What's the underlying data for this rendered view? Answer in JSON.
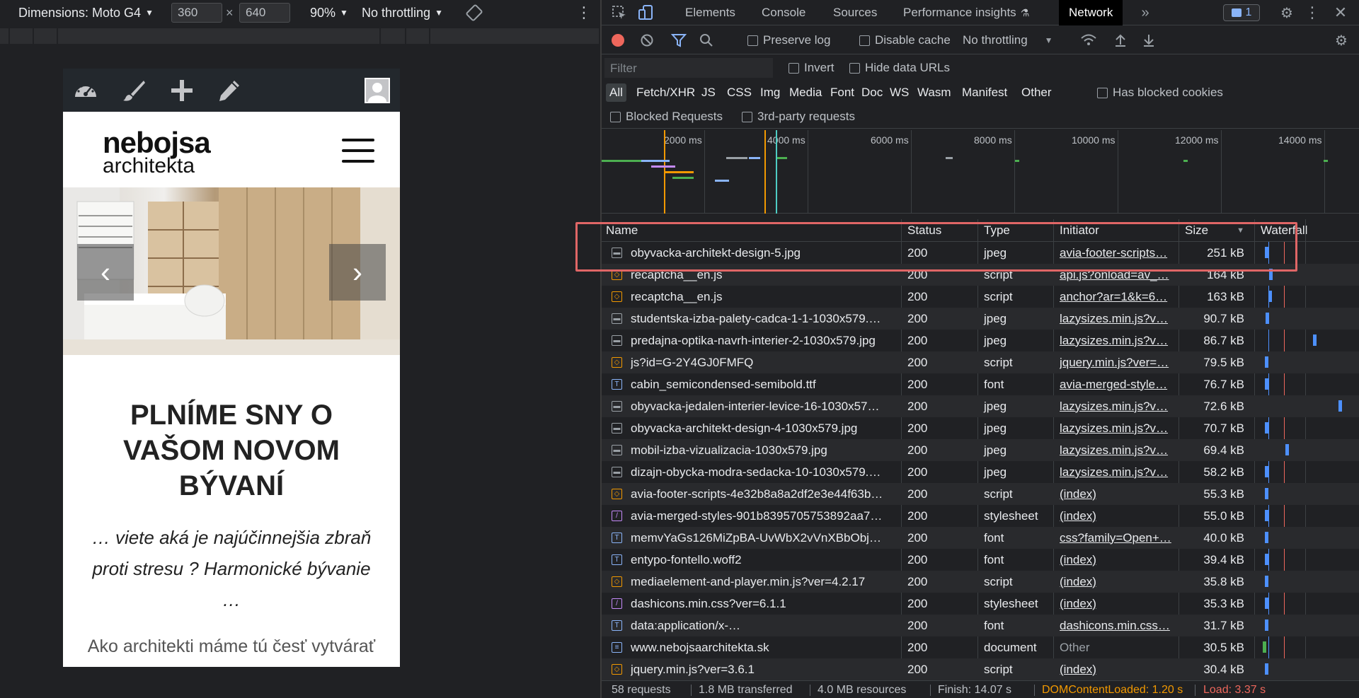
{
  "device_toolbar": {
    "dimensions_label": "Dimensions: Moto G4",
    "width": "360",
    "times": "×",
    "height": "640",
    "zoom": "90%",
    "throttling": "No throttling"
  },
  "page": {
    "logo_line1": "nebojsa",
    "logo_line2": "architekta",
    "headline": "PLNÍME SNY O VAŠOM NOVOM BÝVANÍ",
    "subline": "… viete aká je najúčinnejšia zbraň proti stresu ? Harmonické bývanie …",
    "bodytext": "Ako architekti máme tú česť vytvárať"
  },
  "devtools": {
    "tabs": [
      "Elements",
      "Console",
      "Sources",
      "Performance insights",
      "Network"
    ],
    "issues_count": "1",
    "network_toolbar": {
      "preserve_log": "Preserve log",
      "disable_cache": "Disable cache",
      "throttling": "No throttling"
    },
    "filter": {
      "placeholder": "Filter",
      "invert": "Invert",
      "hide_data_urls": "Hide data URLs"
    },
    "types": [
      "All",
      "Fetch/XHR",
      "JS",
      "CSS",
      "Img",
      "Media",
      "Font",
      "Doc",
      "WS",
      "Wasm",
      "Manifest",
      "Other"
    ],
    "has_blocked_cookies": "Has blocked cookies",
    "blocked_requests": "Blocked Requests",
    "third_party": "3rd-party requests",
    "timeline_labels": [
      "2000 ms",
      "4000 ms",
      "6000 ms",
      "8000 ms",
      "10000 ms",
      "12000 ms",
      "14000 ms"
    ],
    "columns": {
      "name": "Name",
      "status": "Status",
      "type": "Type",
      "initiator": "Initiator",
      "size": "Size",
      "waterfall": "Waterfall"
    },
    "requests": [
      {
        "name": "obyvacka-architekt-design-5.jpg",
        "status": "200",
        "type": "jpeg",
        "initiator": "avia-footer-scripts…",
        "size": "251 kB",
        "kind": "img",
        "init_link": true,
        "wf": 0.03
      },
      {
        "name": "recaptcha__en.js",
        "status": "200",
        "type": "script",
        "initiator": "api.js?onload=av_…",
        "size": "164 kB",
        "kind": "script",
        "init_link": true,
        "wf": 0.08
      },
      {
        "name": "recaptcha__en.js",
        "status": "200",
        "type": "script",
        "initiator": "anchor?ar=1&k=6…",
        "size": "163 kB",
        "kind": "script",
        "init_link": true,
        "wf": 0.07
      },
      {
        "name": "studentska-izba-palety-cadca-1-1-1030x579.…",
        "status": "200",
        "type": "jpeg",
        "initiator": "lazysizes.min.js?v…",
        "size": "90.7 kB",
        "kind": "img",
        "init_link": true,
        "wf": 0.04
      },
      {
        "name": "predajna-optika-navrh-interier-2-1030x579.jpg",
        "status": "200",
        "type": "jpeg",
        "initiator": "lazysizes.min.js?v…",
        "size": "86.7 kB",
        "kind": "img",
        "init_link": true,
        "wf": 0.57
      },
      {
        "name": "js?id=G-2Y4GJ0FMFQ",
        "status": "200",
        "type": "script",
        "initiator": "jquery.min.js?ver=…",
        "size": "79.5 kB",
        "kind": "script",
        "init_link": true,
        "wf": 0.03
      },
      {
        "name": "cabin_semicondensed-semibold.ttf",
        "status": "200",
        "type": "font",
        "initiator": "avia-merged-style…",
        "size": "76.7 kB",
        "kind": "font",
        "init_link": true,
        "wf": 0.03
      },
      {
        "name": "obyvacka-jedalen-interier-levice-16-1030x57…",
        "status": "200",
        "type": "jpeg",
        "initiator": "lazysizes.min.js?v…",
        "size": "72.6 kB",
        "kind": "img",
        "init_link": true,
        "wf": 0.85
      },
      {
        "name": "obyvacka-architekt-design-4-1030x579.jpg",
        "status": "200",
        "type": "jpeg",
        "initiator": "lazysizes.min.js?v…",
        "size": "70.7 kB",
        "kind": "img",
        "init_link": true,
        "wf": 0.03
      },
      {
        "name": "mobil-izba-vizualizacia-1030x579.jpg",
        "status": "200",
        "type": "jpeg",
        "initiator": "lazysizes.min.js?v…",
        "size": "69.4 kB",
        "kind": "img",
        "init_link": true,
        "wf": 0.26
      },
      {
        "name": "dizajn-obycka-modra-sedacka-10-1030x579.…",
        "status": "200",
        "type": "jpeg",
        "initiator": "lazysizes.min.js?v…",
        "size": "58.2 kB",
        "kind": "img",
        "init_link": true,
        "wf": 0.03
      },
      {
        "name": "avia-footer-scripts-4e32b8a8a2df2e3e44f63b…",
        "status": "200",
        "type": "script",
        "initiator": "(index)",
        "size": "55.3 kB",
        "kind": "script",
        "init_link": true,
        "wf": 0.03
      },
      {
        "name": "avia-merged-styles-901b8395705753892aa7…",
        "status": "200",
        "type": "stylesheet",
        "initiator": "(index)",
        "size": "55.0 kB",
        "kind": "css",
        "init_link": true,
        "wf": 0.03
      },
      {
        "name": "memvYaGs126MiZpBA-UvWbX2vVnXBbObj…",
        "status": "200",
        "type": "font",
        "initiator": "css?family=Open+…",
        "size": "40.0 kB",
        "kind": "font",
        "init_link": true,
        "wf": 0.03
      },
      {
        "name": "entypo-fontello.woff2",
        "status": "200",
        "type": "font",
        "initiator": "(index)",
        "size": "39.4 kB",
        "kind": "font",
        "init_link": true,
        "wf": 0.03
      },
      {
        "name": "mediaelement-and-player.min.js?ver=4.2.17",
        "status": "200",
        "type": "script",
        "initiator": "(index)",
        "size": "35.8 kB",
        "kind": "script",
        "init_link": true,
        "wf": 0.03
      },
      {
        "name": "dashicons.min.css?ver=6.1.1",
        "status": "200",
        "type": "stylesheet",
        "initiator": "(index)",
        "size": "35.3 kB",
        "kind": "css",
        "init_link": true,
        "wf": 0.03
      },
      {
        "name": "data:application/x-…",
        "status": "200",
        "type": "font",
        "initiator": "dashicons.min.css…",
        "size": "31.7 kB",
        "kind": "font",
        "init_link": true,
        "wf": 0.03
      },
      {
        "name": "www.nebojsaarchitekta.sk",
        "status": "200",
        "type": "document",
        "initiator": "Other",
        "size": "30.5 kB",
        "kind": "doc",
        "init_link": false,
        "wf": 0.01
      },
      {
        "name": "jquery.min.js?ver=3.6.1",
        "status": "200",
        "type": "script",
        "initiator": "(index)",
        "size": "30.4 kB",
        "kind": "script",
        "init_link": true,
        "wf": 0.03
      }
    ],
    "status_bar": {
      "requests": "58 requests",
      "transferred": "1.8 MB transferred",
      "resources": "4.0 MB resources",
      "finish": "Finish: 14.07 s",
      "domcontentloaded": "DOMContentLoaded: 1.20 s",
      "load": "Load: 3.37 s"
    }
  },
  "colors": {
    "domcontentloaded": "#f29900",
    "load": "#ee675c",
    "accent": "#8ab4f8"
  }
}
